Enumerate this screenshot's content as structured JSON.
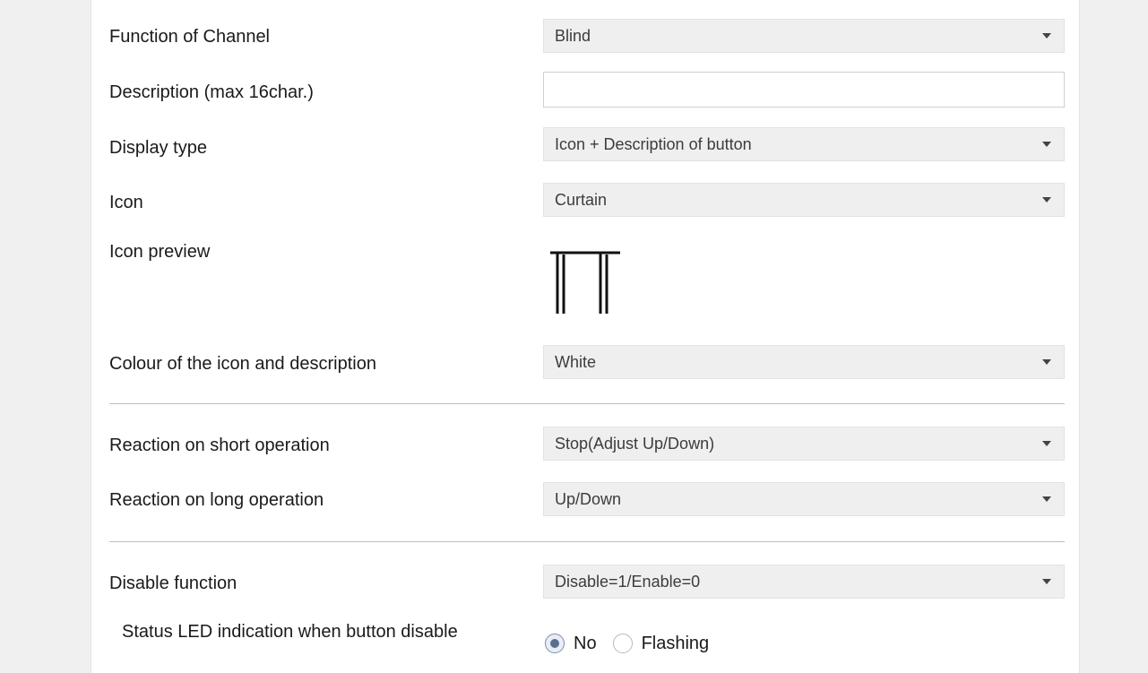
{
  "fields": {
    "function_of_channel": {
      "label": "Function of Channel",
      "value": "Blind"
    },
    "description": {
      "label": "Description (max 16char.)",
      "value": ""
    },
    "display_type": {
      "label": "Display type",
      "value": "Icon + Description of button"
    },
    "icon": {
      "label": "Icon",
      "value": "Curtain"
    },
    "icon_preview": {
      "label": "Icon preview",
      "icon_name": "curtain-icon"
    },
    "colour": {
      "label": "Colour of the icon and description",
      "value": "White"
    },
    "reaction_short": {
      "label": "Reaction on short operation",
      "value": "Stop(Adjust Up/Down)"
    },
    "reaction_long": {
      "label": "Reaction on long operation",
      "value": "Up/Down"
    },
    "disable_function": {
      "label": "Disable function",
      "value": "Disable=1/Enable=0"
    },
    "status_led": {
      "label": "Status LED indication when button disable",
      "options": [
        "No",
        "Flashing"
      ],
      "selected": "No"
    }
  },
  "colors": {
    "panel_background": "#ffffff",
    "select_background": "#efefef",
    "radio_checked": "#5a6f90"
  }
}
